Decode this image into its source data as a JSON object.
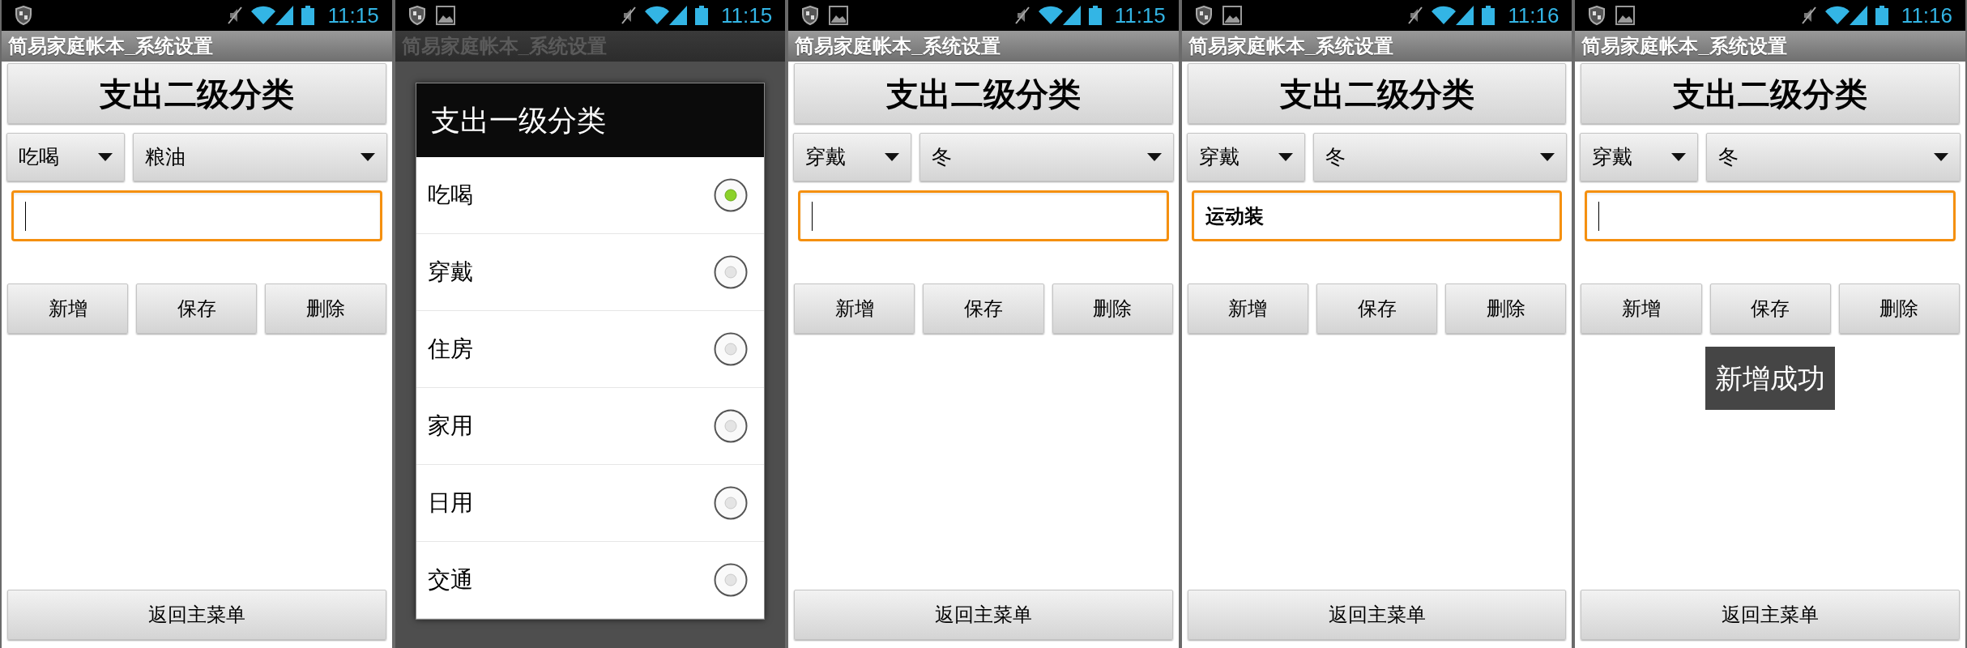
{
  "screens": [
    {
      "kind": "form",
      "status_bar": {
        "time": "11:15",
        "image_notification": false
      },
      "title": "简易家庭帐本_系统设置",
      "header_button": "支出二级分类",
      "spinners": [
        "吃喝",
        "粮油"
      ],
      "buttons": [
        "新增",
        "保存",
        "删除"
      ],
      "bottom_button": "返回主菜单"
    },
    {
      "kind": "dialog",
      "status_bar": {
        "time": "11:15",
        "image_notification": true
      },
      "title": "简易家庭帐本_系统设置",
      "dialog": {
        "title": "支出一级分类",
        "options": [
          {
            "label": "吃喝",
            "selected": true
          },
          {
            "label": "穿戴",
            "selected": false
          },
          {
            "label": "住房",
            "selected": false
          },
          {
            "label": "家用",
            "selected": false
          },
          {
            "label": "日用",
            "selected": false
          },
          {
            "label": "交通",
            "selected": false
          }
        ]
      }
    },
    {
      "kind": "form",
      "status_bar": {
        "time": "11:15",
        "image_notification": true
      },
      "title": "简易家庭帐本_系统设置",
      "header_button": "支出二级分类",
      "spinners": [
        "穿戴",
        "冬"
      ],
      "buttons": [
        "新增",
        "保存",
        "删除"
      ],
      "bottom_button": "返回主菜单"
    },
    {
      "kind": "form",
      "status_bar": {
        "time": "11:16",
        "image_notification": true
      },
      "title": "简易家庭帐本_系统设置",
      "header_button": "支出二级分类",
      "spinners": [
        "穿戴",
        "冬"
      ],
      "input": {
        "value": "运动装"
      },
      "buttons": [
        "新增",
        "保存",
        "删除"
      ],
      "bottom_button": "返回主菜单"
    },
    {
      "kind": "form",
      "status_bar": {
        "time": "11:16",
        "image_notification": true
      },
      "title": "简易家庭帐本_系统设置",
      "header_button": "支出二级分类",
      "spinners": [
        "穿戴",
        "冬"
      ],
      "buttons": [
        "新增",
        "保存",
        "删除"
      ],
      "toast": "新增成功",
      "bottom_button": "返回主菜单"
    }
  ]
}
